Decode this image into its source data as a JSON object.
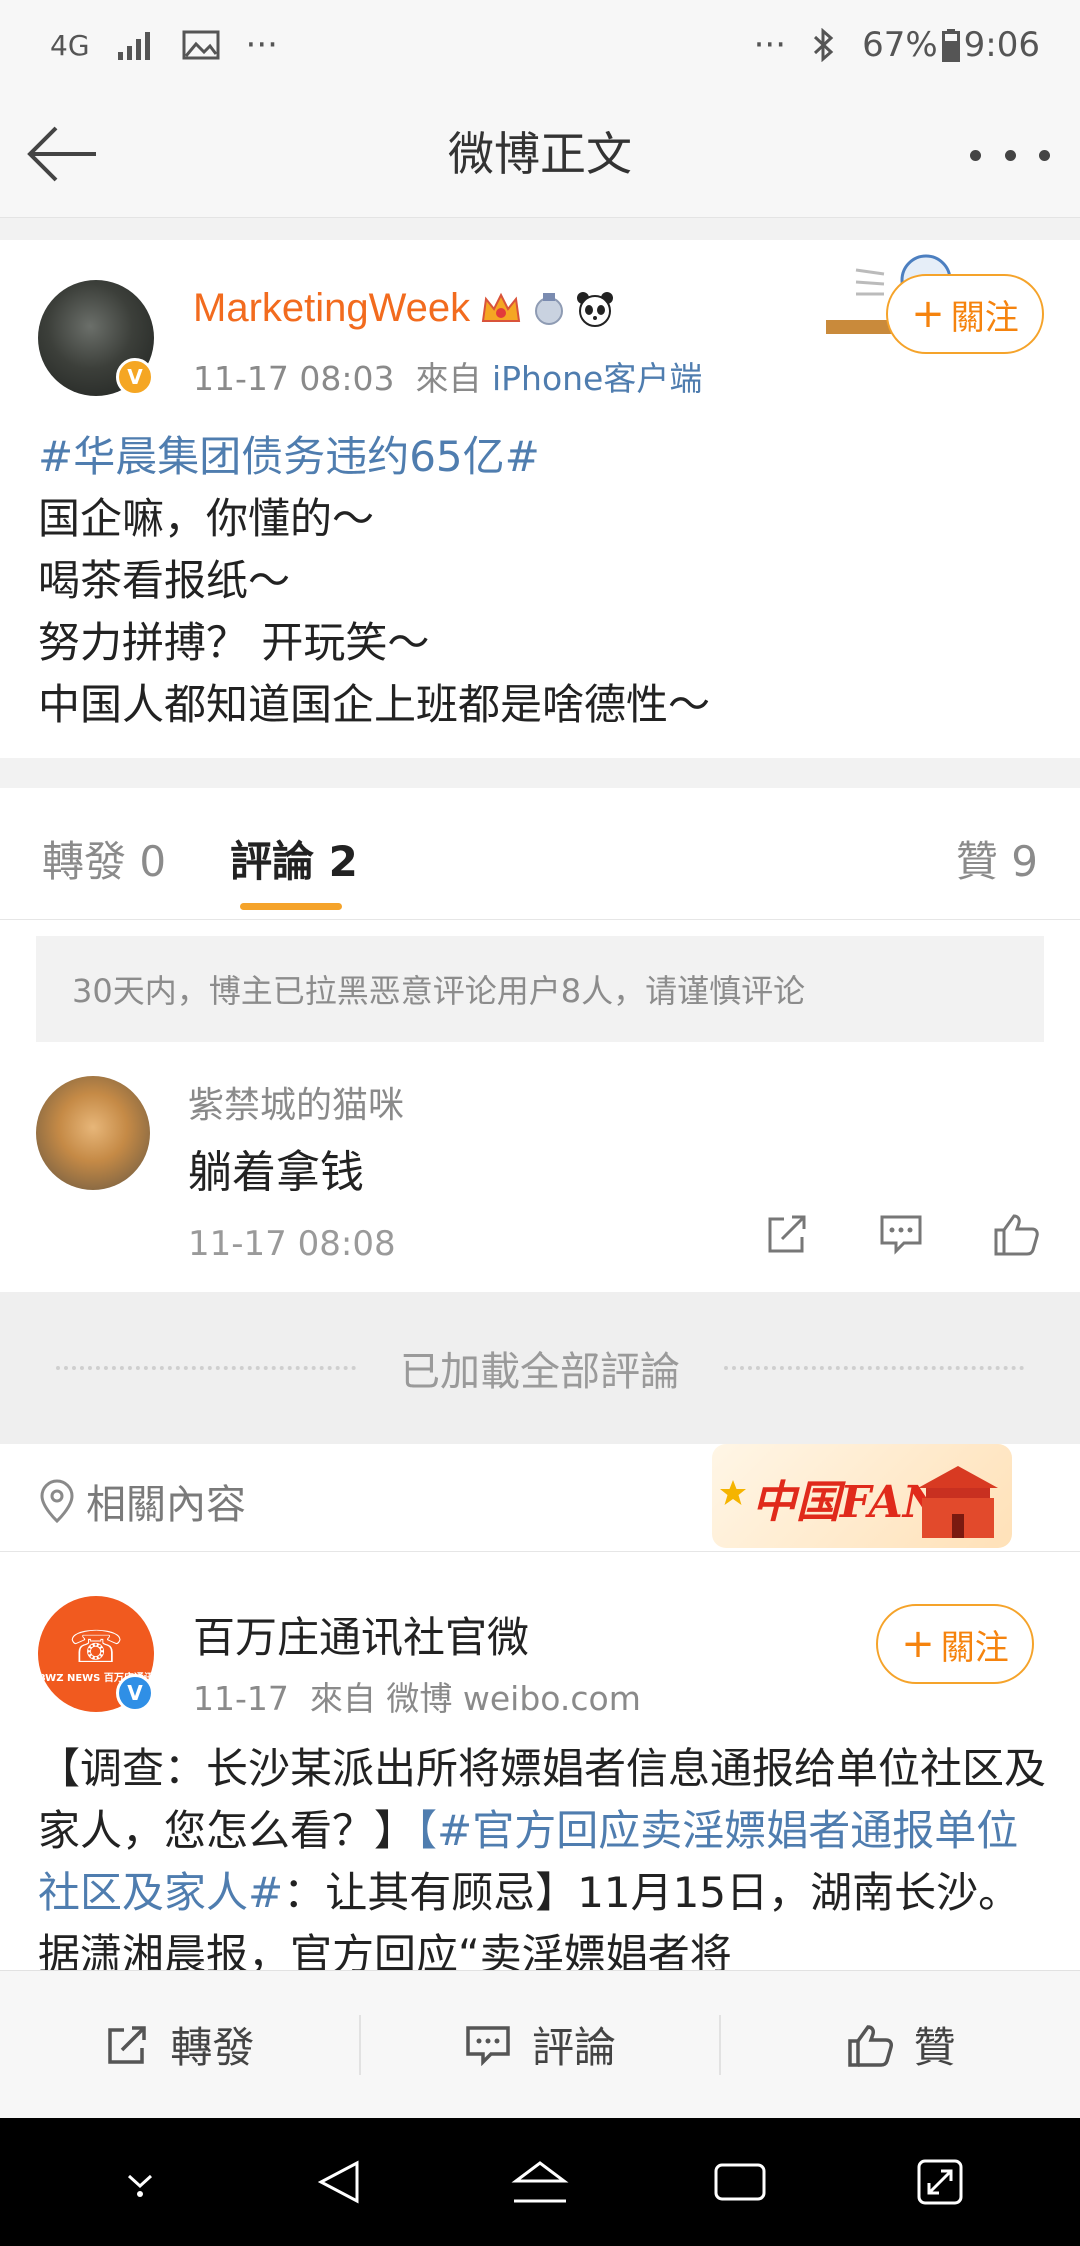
{
  "status_bar": {
    "network": "4G",
    "extra_left": "···",
    "extra_right": "···",
    "battery": "67%",
    "time": "9:06"
  },
  "header": {
    "title": "微博正文"
  },
  "post": {
    "author": "MarketingWeek",
    "time": "11-17 08:03",
    "from_label": "來自",
    "source": "iPhone客户端",
    "follow_label": "關注",
    "hashtag": "#华晨集团债务违约65亿#",
    "lines": [
      "国企嘛，你懂的～",
      "喝茶看报纸～",
      "努力拼搏？ 开玩笑～",
      "中国人都知道国企上班都是啥德性～"
    ]
  },
  "tabs": {
    "repost": "轉發 0",
    "comment": "評論 2",
    "like": "贊 9"
  },
  "notice": "30天内，博主已拉黑恶意评论用户8人，请谨慎评论",
  "comment": {
    "author": "紫禁城的猫咪",
    "text": "躺着拿钱",
    "time": "11-17 08:08"
  },
  "loaded_all": "已加載全部評論",
  "related": {
    "label": "相關內容",
    "banner": "中国FANS"
  },
  "post2": {
    "author": "百万庄通讯社官微",
    "time": "11-17",
    "from_label": "來自",
    "source": "微博 weibo.com",
    "follow_label": "關注",
    "avatar_text": "BWZ NEWS 百万庄通讯",
    "text_part1": "【调查：长沙某派出所将嫖娼者信息通报给单位社区及家人，您怎么看？】",
    "hashtag": "【#官方回应卖淫嫖娼者通报单位社区及家人#",
    "text_part2": "：让其有顾忌】11月15日，湖南长沙。据潇湘晨报，官方回应“卖淫嫖娼者将"
  },
  "action_bar": {
    "repost": "轉發",
    "comment": "評論",
    "like": "贊"
  },
  "colors": {
    "accent_orange": "#f5a32a",
    "username_orange": "#f26b1e",
    "link_blue": "#4f7daf",
    "verified_gold": "#f5a623",
    "verified_blue": "#2f8fe6"
  }
}
